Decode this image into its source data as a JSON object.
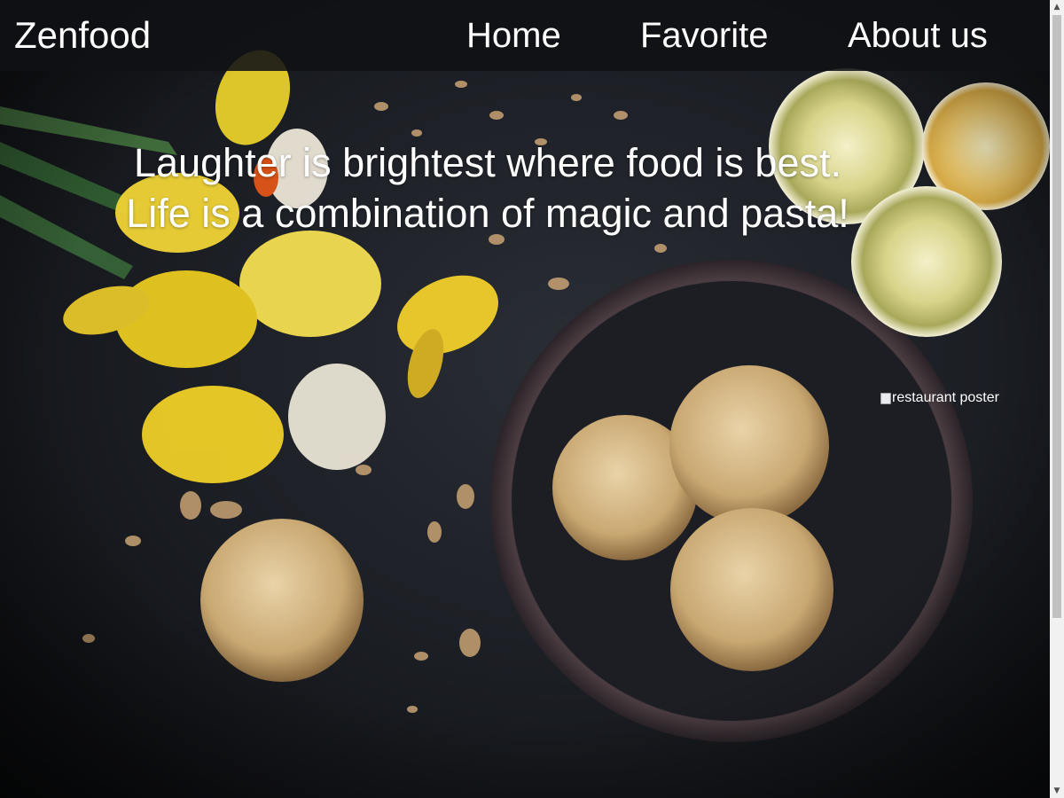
{
  "header": {
    "brand": "Zenfood",
    "nav": [
      {
        "label": "Home"
      },
      {
        "label": "Favorite"
      },
      {
        "label": "About us"
      }
    ]
  },
  "hero": {
    "quote_line1": "Laughter is brightest where food is best.",
    "quote_line2": "Life is a combination of magic and pasta!",
    "poster_alt": "restaurant poster"
  },
  "icons": {
    "broken_image": "broken-image-icon",
    "scroll_up": "scroll-up-arrow-icon",
    "scroll_down": "scroll-down-arrow-icon"
  },
  "colors": {
    "navbar_bg": "#101114",
    "text": "#ffffff",
    "background": "#1d2026"
  }
}
